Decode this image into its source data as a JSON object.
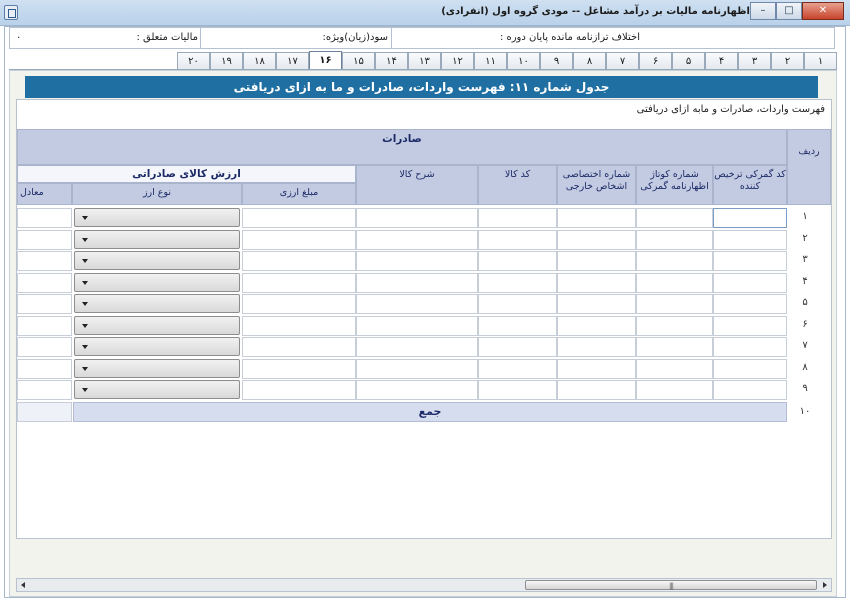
{
  "window": {
    "title": "اظهارنامه مالیات بر درآمد مشاغل -- مودی گروه اول (انفرادی)",
    "minimize_glyph": "–",
    "maximize_glyph": "□",
    "close_glyph": "✕"
  },
  "info": {
    "tax_label": "مالیات متعلق :",
    "tax_value": "۰",
    "profit_label": "سود(زیان)ویژه:",
    "balance_label": "اختلاف ترازنامه مانده پایان دوره :"
  },
  "tabs": [
    "۱",
    "۲",
    "۳",
    "۴",
    "۵",
    "۶",
    "۷",
    "۸",
    "۹",
    "۱۰",
    "۱۱",
    "۱۲",
    "۱۳",
    "۱۴",
    "۱۵",
    "۱۶",
    "۱۷",
    "۱۸",
    "۱۹",
    "۲۰"
  ],
  "active_tab": "۱۶",
  "page": {
    "banner": "جدول شماره ۱۱: فهرست واردات، صادرات و ما به ازای دریافتی",
    "subtitle": "فهرست واردات، صادرات و مابه ازای دریافتی"
  },
  "table": {
    "group_header": "صادرات",
    "row_header": "ردیف",
    "columns": {
      "customs_code": "کد گمرکی ترخیص کننده",
      "declaration_no": "شماره کوتاژ اظهارنامه گمرکی",
      "exclusive_no": "شماره اختصاصی اشخاص خارجی",
      "goods_code": "کد کالا",
      "goods_desc": "شرح کالا",
      "export_value": "ارزش کالای صادراتی",
      "currency_amount": "مبلغ ارزی",
      "currency_type": "نوع ارز",
      "equivalent": "معادل"
    },
    "rows": [
      "۱",
      "۲",
      "۳",
      "۴",
      "۵",
      "۶",
      "۷",
      "۸",
      "۹"
    ],
    "total_row_number": "۱۰",
    "total_label": "جمع"
  },
  "scrollbar": {
    "grip": "|||"
  }
}
